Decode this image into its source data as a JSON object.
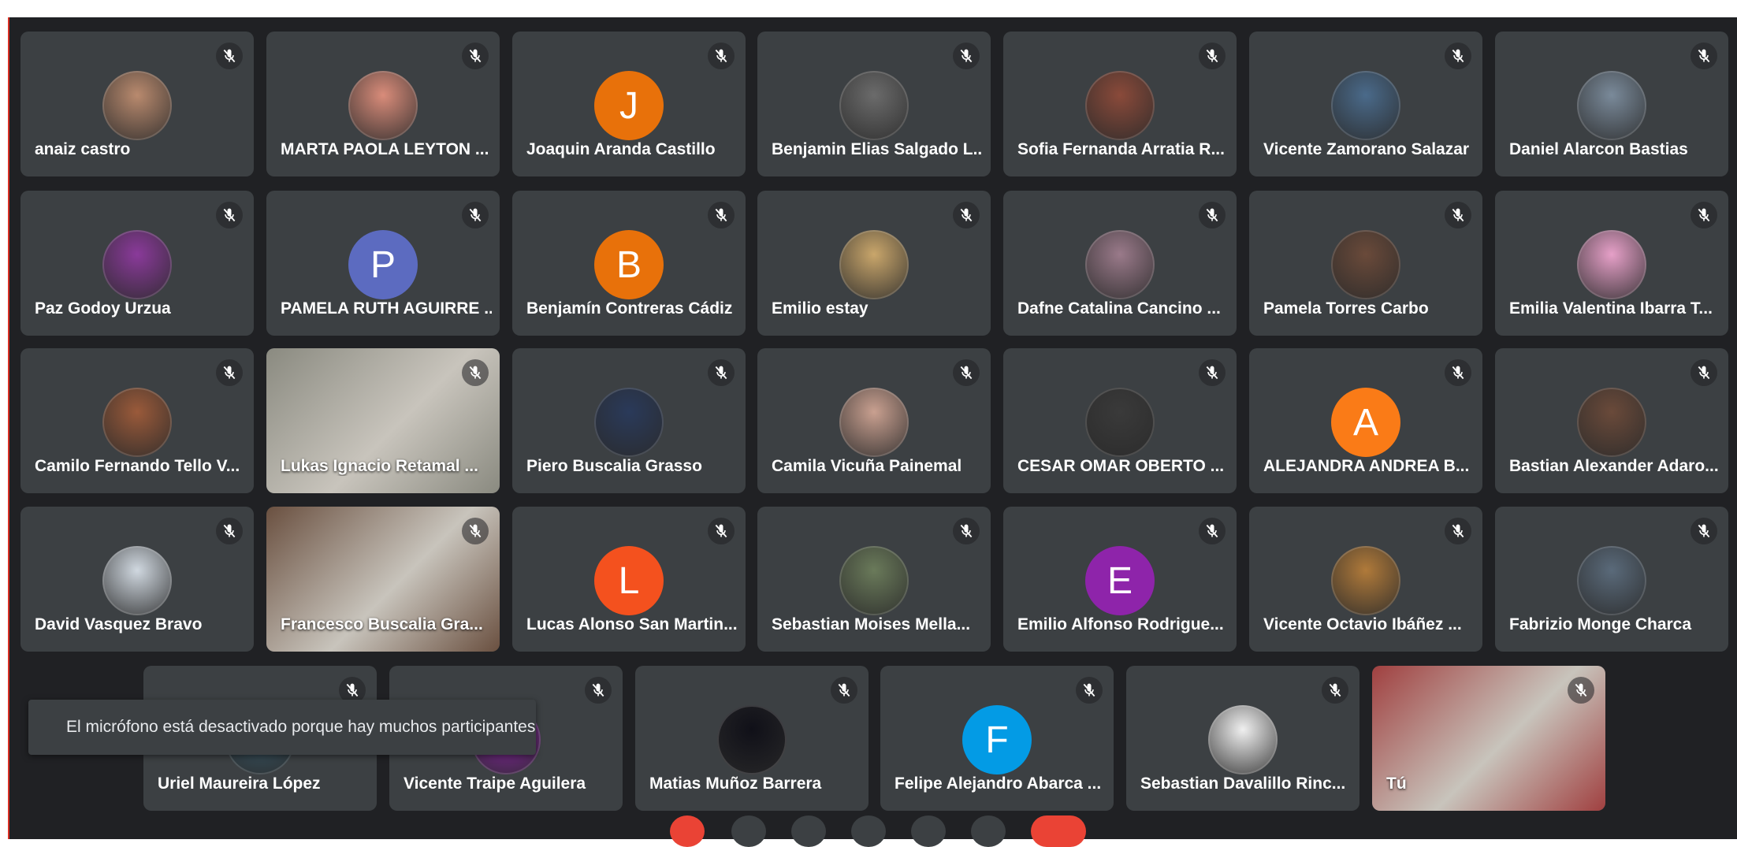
{
  "participants": [
    {
      "name": "anaiz castro",
      "avatar_type": "photo",
      "color": "#b98a6e"
    },
    {
      "name": "MARTA PAOLA LEYTON ...",
      "avatar_type": "photo",
      "color": "#d98c7a"
    },
    {
      "name": "Joaquin Aranda Castillo",
      "avatar_type": "initial",
      "initial": "J",
      "color": "#e8710a"
    },
    {
      "name": "Benjamin Elias Salgado L...",
      "avatar_type": "photo",
      "color": "#6b6b6b"
    },
    {
      "name": "Sofia Fernanda Arratia R...",
      "avatar_type": "photo",
      "color": "#8a4a3a"
    },
    {
      "name": "Vicente Zamorano Salazar",
      "avatar_type": "photo",
      "color": "#4a6a8a"
    },
    {
      "name": "Daniel Alarcon Bastias",
      "avatar_type": "photo",
      "color": "#7a8a9a"
    },
    {
      "name": "Paz Godoy Urzua",
      "avatar_type": "photo",
      "color": "#8a3a9a"
    },
    {
      "name": "PAMELA RUTH AGUIRRE ...",
      "avatar_type": "initial",
      "initial": "P",
      "color": "#5c6bc0"
    },
    {
      "name": "Benjamín Contreras Cádiz",
      "avatar_type": "initial",
      "initial": "B",
      "color": "#e8710a"
    },
    {
      "name": "Emilio estay",
      "avatar_type": "photo",
      "color": "#c9a66b"
    },
    {
      "name": "Dafne Catalina Cancino ...",
      "avatar_type": "photo",
      "color": "#9a7a8a"
    },
    {
      "name": "Pamela Torres Carbo",
      "avatar_type": "photo",
      "color": "#6a4a3a"
    },
    {
      "name": "Emilia Valentina Ibarra T...",
      "avatar_type": "photo",
      "color": "#e6a0c8"
    },
    {
      "name": "Camilo Fernando Tello V...",
      "avatar_type": "photo",
      "color": "#9a5a3a"
    },
    {
      "name": "Lukas Ignacio Retamal ...",
      "avatar_type": "video",
      "color": "#8a8a80"
    },
    {
      "name": "Piero Buscalia Grasso",
      "avatar_type": "photo",
      "color": "#2a3a5a"
    },
    {
      "name": "Camila Vicuña Painemal",
      "avatar_type": "photo",
      "color": "#c9a090"
    },
    {
      "name": "CESAR OMAR OBERTO ...",
      "avatar_type": "photo",
      "color": "#3a3a3a"
    },
    {
      "name": "ALEJANDRA ANDREA B...",
      "avatar_type": "initial",
      "initial": "A",
      "color": "#fa7b17"
    },
    {
      "name": "Bastian Alexander Adaro...",
      "avatar_type": "photo",
      "color": "#6a4a3a"
    },
    {
      "name": "David Vasquez Bravo",
      "avatar_type": "photo",
      "color": "#d0d8e0"
    },
    {
      "name": "Francesco Buscalia Gra...",
      "avatar_type": "video",
      "color": "#6a5040"
    },
    {
      "name": "Lucas Alonso San Martin...",
      "avatar_type": "initial",
      "initial": "L",
      "color": "#f4511e"
    },
    {
      "name": "Sebastian Moises Mella...",
      "avatar_type": "photo",
      "color": "#6a7a5a"
    },
    {
      "name": "Emilio Alfonso Rodrigue...",
      "avatar_type": "initial",
      "initial": "E",
      "color": "#8e24aa"
    },
    {
      "name": "Vicente Octavio Ibáñez ...",
      "avatar_type": "photo",
      "color": "#b07a3a"
    },
    {
      "name": "Fabrizio Monge Charca",
      "avatar_type": "photo",
      "color": "#5a6a7a"
    },
    {
      "name": "Uriel Maureira López",
      "avatar_type": "photo",
      "color": "#3a5a6a"
    },
    {
      "name": "Vicente Traipe Aguilera",
      "avatar_type": "photo",
      "color": "#8e24aa"
    },
    {
      "name": "Matias Muñoz Barrera",
      "avatar_type": "photo",
      "color": "#101018"
    },
    {
      "name": "Felipe Alejandro Abarca ...",
      "avatar_type": "initial",
      "initial": "F",
      "color": "#039be5"
    },
    {
      "name": "Sebastian Davalillo Rinc...",
      "avatar_type": "photo",
      "color": "#f0f0f0"
    },
    {
      "name": "Tú",
      "avatar_type": "video",
      "color": "#a04040"
    }
  ],
  "toast": {
    "message": "El micrófono está desactivado porque hay muchos participantes"
  },
  "icons": {
    "mic": "mic-off-icon"
  },
  "colors": {
    "tile_bg": "#3c4043",
    "stage_bg": "#202124",
    "hangup": "#ea4335"
  }
}
